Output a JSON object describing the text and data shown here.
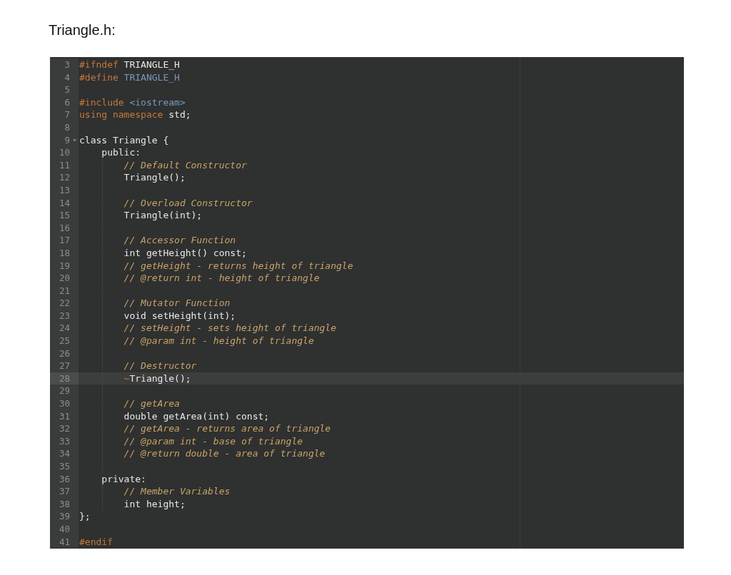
{
  "title": "Triangle.h:",
  "editor": {
    "lines": [
      {
        "number": "3",
        "current": false,
        "fold": false,
        "guide": false,
        "tokens": [
          {
            "kind": "preproc",
            "text": "#ifndef"
          },
          {
            "kind": "plain",
            "text": " TRIANGLE_H"
          }
        ]
      },
      {
        "number": "4",
        "current": false,
        "fold": false,
        "guide": false,
        "tokens": [
          {
            "kind": "preproc",
            "text": "#define"
          },
          {
            "kind": "name",
            "text": " TRIANGLE_H"
          }
        ]
      },
      {
        "number": "5",
        "current": false,
        "fold": false,
        "guide": false
      },
      {
        "number": "6",
        "current": false,
        "fold": false,
        "guide": false,
        "tokens": [
          {
            "kind": "preproc",
            "text": "#include"
          },
          {
            "kind": "name",
            "text": " <iostream>"
          }
        ]
      },
      {
        "number": "7",
        "current": false,
        "fold": false,
        "guide": false,
        "tokens": [
          {
            "kind": "preproc",
            "text": "using namespace"
          },
          {
            "kind": "plain",
            "text": " std;"
          }
        ]
      },
      {
        "number": "8",
        "current": false,
        "fold": false,
        "guide": false
      },
      {
        "number": "9",
        "current": false,
        "fold": true,
        "guide": false,
        "tokens": [
          {
            "kind": "plain",
            "text": "class Triangle {"
          }
        ]
      },
      {
        "number": "10",
        "current": false,
        "fold": false,
        "guide": false,
        "tokens": [
          {
            "kind": "plain",
            "text": "    public:"
          }
        ]
      },
      {
        "number": "11",
        "current": false,
        "fold": false,
        "guide": true,
        "tokens": [
          {
            "kind": "comment",
            "text": "        // Default Constructor"
          }
        ]
      },
      {
        "number": "12",
        "current": false,
        "fold": false,
        "guide": true,
        "tokens": [
          {
            "kind": "plain",
            "text": "        Triangle();"
          }
        ]
      },
      {
        "number": "13",
        "current": false,
        "fold": false,
        "guide": true
      },
      {
        "number": "14",
        "current": false,
        "fold": false,
        "guide": true,
        "tokens": [
          {
            "kind": "comment",
            "text": "        // Overload Constructor"
          }
        ]
      },
      {
        "number": "15",
        "current": false,
        "fold": false,
        "guide": true,
        "tokens": [
          {
            "kind": "plain",
            "text": "        Triangle(int);"
          }
        ]
      },
      {
        "number": "16",
        "current": false,
        "fold": false,
        "guide": true
      },
      {
        "number": "17",
        "current": false,
        "fold": false,
        "guide": true,
        "tokens": [
          {
            "kind": "comment",
            "text": "        // Accessor Function"
          }
        ]
      },
      {
        "number": "18",
        "current": false,
        "fold": false,
        "guide": true,
        "tokens": [
          {
            "kind": "plain",
            "text": "        int getHeight() const;"
          }
        ]
      },
      {
        "number": "19",
        "current": false,
        "fold": false,
        "guide": true,
        "tokens": [
          {
            "kind": "comment",
            "text": "        // getHeight - returns height of triangle"
          }
        ]
      },
      {
        "number": "20",
        "current": false,
        "fold": false,
        "guide": true,
        "tokens": [
          {
            "kind": "comment",
            "text": "        // @return int - height of triangle"
          }
        ]
      },
      {
        "number": "21",
        "current": false,
        "fold": false,
        "guide": true
      },
      {
        "number": "22",
        "current": false,
        "fold": false,
        "guide": true,
        "tokens": [
          {
            "kind": "comment",
            "text": "        // Mutator Function"
          }
        ]
      },
      {
        "number": "23",
        "current": false,
        "fold": false,
        "guide": true,
        "tokens": [
          {
            "kind": "plain",
            "text": "        void setHeight(int);"
          }
        ]
      },
      {
        "number": "24",
        "current": false,
        "fold": false,
        "guide": true,
        "tokens": [
          {
            "kind": "comment",
            "text": "        // setHeight - sets height of triangle"
          }
        ]
      },
      {
        "number": "25",
        "current": false,
        "fold": false,
        "guide": true,
        "tokens": [
          {
            "kind": "comment",
            "text": "        // @param int - height of triangle"
          }
        ]
      },
      {
        "number": "26",
        "current": false,
        "fold": false,
        "guide": true
      },
      {
        "number": "27",
        "current": false,
        "fold": false,
        "guide": true,
        "tokens": [
          {
            "kind": "comment",
            "text": "        // Destructor"
          }
        ]
      },
      {
        "number": "28",
        "current": true,
        "fold": false,
        "guide": true,
        "tokens": [
          {
            "kind": "preproc",
            "text": "        ~"
          },
          {
            "kind": "plain",
            "text": "Triangle();"
          }
        ]
      },
      {
        "number": "29",
        "current": false,
        "fold": false,
        "guide": true
      },
      {
        "number": "30",
        "current": false,
        "fold": false,
        "guide": true,
        "tokens": [
          {
            "kind": "comment",
            "text": "        // getArea"
          }
        ]
      },
      {
        "number": "31",
        "current": false,
        "fold": false,
        "guide": true,
        "tokens": [
          {
            "kind": "plain",
            "text": "        double getArea(int) const;"
          }
        ]
      },
      {
        "number": "32",
        "current": false,
        "fold": false,
        "guide": true,
        "tokens": [
          {
            "kind": "comment",
            "text": "        // getArea - returns area of triangle"
          }
        ]
      },
      {
        "number": "33",
        "current": false,
        "fold": false,
        "guide": true,
        "tokens": [
          {
            "kind": "comment",
            "text": "        // @param int - base of triangle"
          }
        ]
      },
      {
        "number": "34",
        "current": false,
        "fold": false,
        "guide": true,
        "tokens": [
          {
            "kind": "comment",
            "text": "        // @return double - area of triangle"
          }
        ]
      },
      {
        "number": "35",
        "current": false,
        "fold": false,
        "guide": true
      },
      {
        "number": "36",
        "current": false,
        "fold": false,
        "guide": false,
        "tokens": [
          {
            "kind": "plain",
            "text": "    private:"
          }
        ]
      },
      {
        "number": "37",
        "current": false,
        "fold": false,
        "guide": true,
        "tokens": [
          {
            "kind": "comment",
            "text": "        // Member Variables"
          }
        ]
      },
      {
        "number": "38",
        "current": false,
        "fold": false,
        "guide": true,
        "tokens": [
          {
            "kind": "plain",
            "text": "        int height;"
          }
        ]
      },
      {
        "number": "39",
        "current": false,
        "fold": false,
        "guide": false,
        "tokens": [
          {
            "kind": "plain",
            "text": "};"
          }
        ]
      },
      {
        "number": "40",
        "current": false,
        "fold": false,
        "guide": false
      },
      {
        "number": "41",
        "current": false,
        "fold": false,
        "guide": false,
        "tokens": [
          {
            "kind": "preproc",
            "text": "#endif"
          }
        ]
      }
    ]
  }
}
